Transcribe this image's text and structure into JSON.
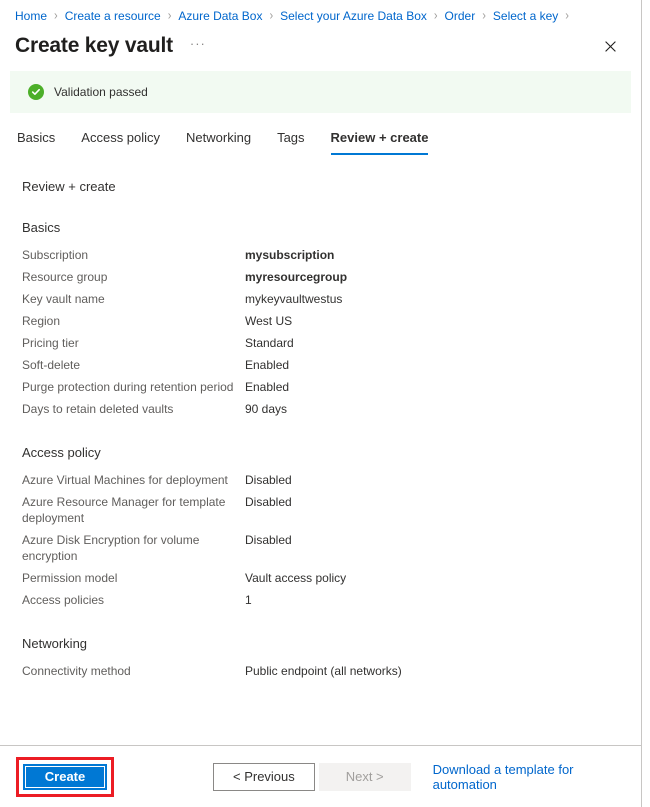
{
  "breadcrumb": {
    "separator": "›",
    "items": [
      {
        "label": "Home"
      },
      {
        "label": "Create a resource"
      },
      {
        "label": "Azure Data Box"
      },
      {
        "label": "Select your Azure Data Box"
      },
      {
        "label": "Order"
      },
      {
        "label": "Select a key"
      }
    ]
  },
  "header": {
    "title": "Create key vault",
    "more_label": "···",
    "close_label": "✕"
  },
  "banner": {
    "icon": "check-circle-icon",
    "text": "Validation passed",
    "background": "#f2faf2",
    "icon_color": "#4caf29"
  },
  "tabs": [
    {
      "label": "Basics",
      "active": false
    },
    {
      "label": "Access policy",
      "active": false
    },
    {
      "label": "Networking",
      "active": false
    },
    {
      "label": "Tags",
      "active": false
    },
    {
      "label": "Review + create",
      "active": true
    }
  ],
  "main": {
    "lead": "Review + create",
    "sections": [
      {
        "title": "Basics",
        "rows": [
          {
            "label": "Subscription",
            "value": "mysubscription",
            "bold": true
          },
          {
            "label": "Resource group",
            "value": "myresourcegroup",
            "bold": true
          },
          {
            "label": "Key vault name",
            "value": "mykeyvaultwestus",
            "bold": false
          },
          {
            "label": "Region",
            "value": "West US",
            "bold": false
          },
          {
            "label": "Pricing tier",
            "value": "Standard",
            "bold": false
          },
          {
            "label": "Soft-delete",
            "value": "Enabled",
            "bold": false
          },
          {
            "label": "Purge protection during retention period",
            "value": "Enabled",
            "bold": false
          },
          {
            "label": "Days to retain deleted vaults",
            "value": "90 days",
            "bold": false
          }
        ]
      },
      {
        "title": "Access policy",
        "rows": [
          {
            "label": "Azure Virtual Machines for deployment",
            "value": "Disabled",
            "bold": false
          },
          {
            "label": "Azure Resource Manager for template deployment",
            "value": "Disabled",
            "bold": false
          },
          {
            "label": "Azure Disk Encryption for volume encryption",
            "value": "Disabled",
            "bold": false
          },
          {
            "label": "Permission model",
            "value": "Vault access policy",
            "bold": false
          },
          {
            "label": "Access policies",
            "value": "1",
            "bold": false
          }
        ]
      },
      {
        "title": "Networking",
        "rows": [
          {
            "label": "Connectivity method",
            "value": "Public endpoint (all networks)",
            "bold": false
          }
        ]
      }
    ]
  },
  "footer": {
    "create_label": "Create",
    "previous_label": "< Previous",
    "next_label": "Next >",
    "template_link_label": "Download a template for automation",
    "highlight_color": "#ec1c24",
    "primary_color": "#0078d4",
    "link_color": "#0066cc"
  }
}
